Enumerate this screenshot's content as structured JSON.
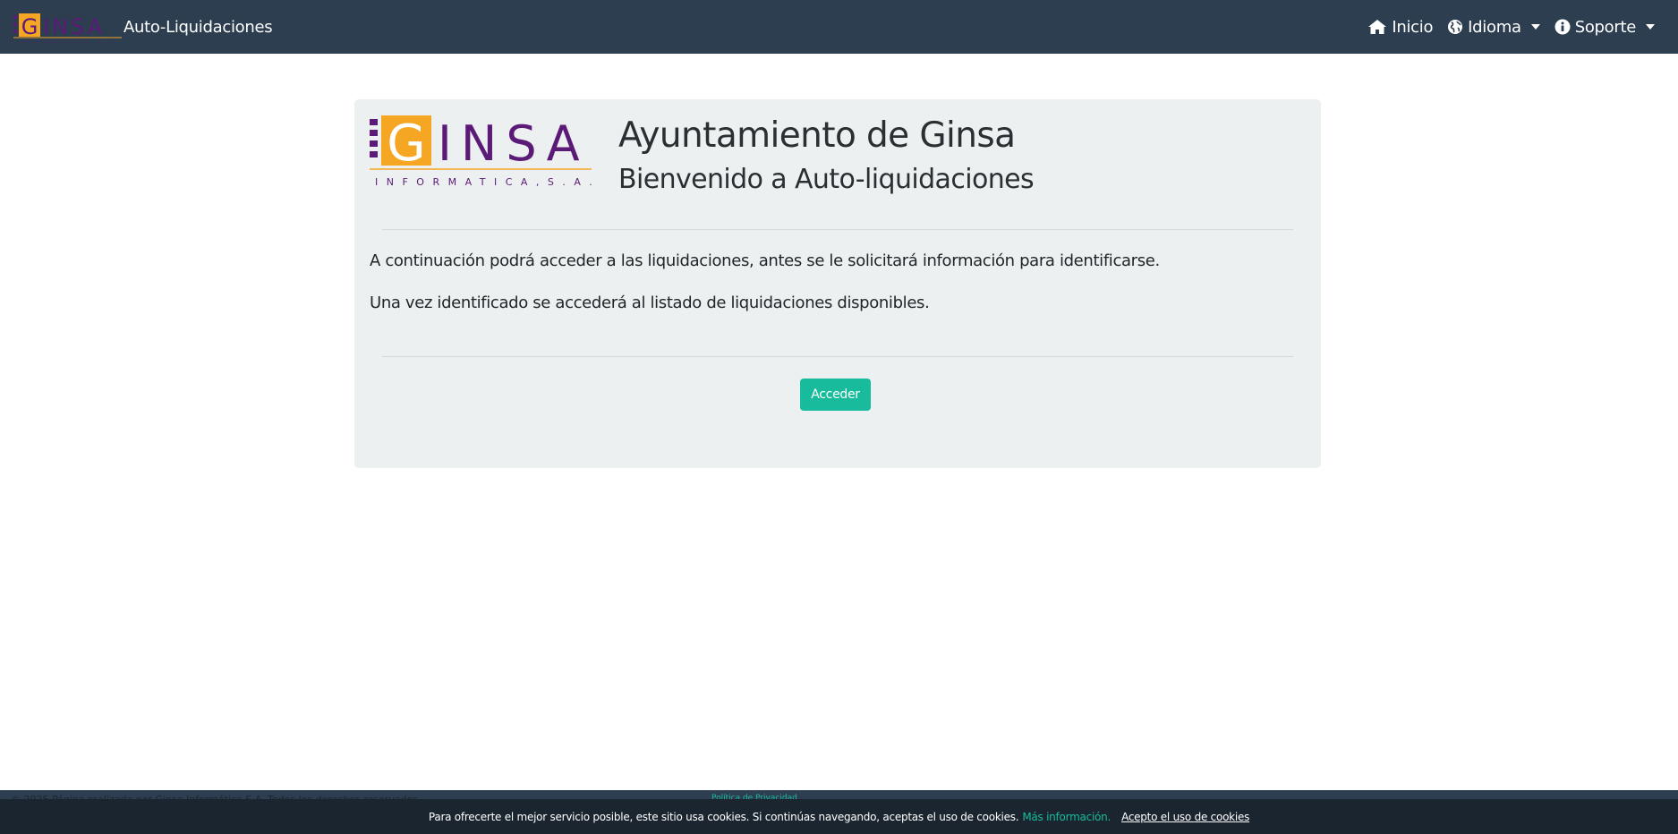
{
  "navbar": {
    "brand_title": "Auto-Liquidaciones",
    "logo_text": "GINSA",
    "items": [
      {
        "label": "Inicio",
        "icon": "home-icon"
      },
      {
        "label": "Idioma",
        "icon": "globe-icon",
        "dropdown": true
      },
      {
        "label": "Soporte",
        "icon": "info-icon",
        "dropdown": true
      }
    ]
  },
  "card": {
    "logo_text": "GINSA",
    "logo_subtext": "INFORMATICA,S.A.",
    "title": "Ayuntamiento de Ginsa",
    "subtitle": "Bienvenido a Auto-liquidaciones",
    "paragraphs": [
      "A continuación podrá acceder a las liquidaciones, antes se le solicitará información para identificarse.",
      "Una vez identificado se accederá al listado de liquidaciones disponibles."
    ],
    "button_label": "Acceder"
  },
  "footer": {
    "copyright": "© 2025 Página realizada por Ginsa Informática S.A. Todos los derechos reservados.",
    "privacy_link": "Política de Privacidad"
  },
  "cookies": {
    "message": "Para ofrecerte el mejor servicio posible, este sitio usa cookies. Si continúas navegando, aceptas el uso de cookies.",
    "more_info": "Más información.",
    "accept": "Acepto el uso de cookies"
  },
  "colors": {
    "navbar_bg": "#2c3e50",
    "card_bg": "#ecf0f1",
    "accent": "#18bc9c",
    "logo_orange": "#f5a623",
    "logo_purple": "#5c1a78",
    "cookie_bg": "#1a252f"
  }
}
